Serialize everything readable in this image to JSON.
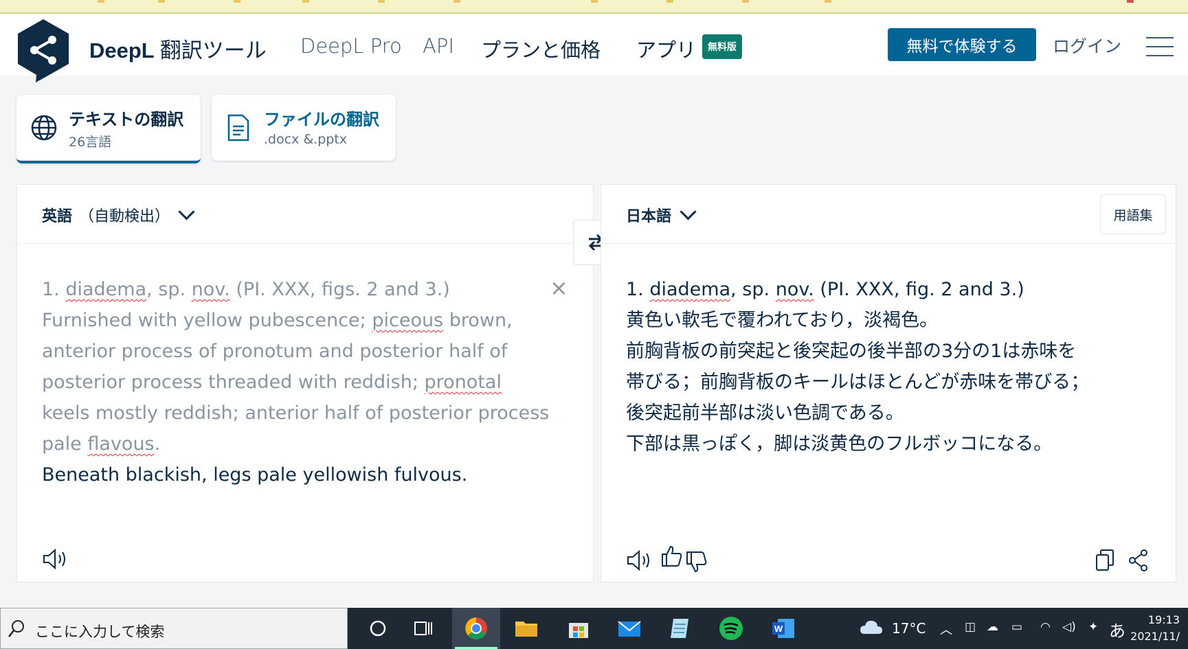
{
  "header": {
    "brand": "DeepL",
    "brand_sub": "翻訳ツール",
    "nav": [
      "DeepL Pro",
      "API",
      "プランと価格",
      "アプリ"
    ],
    "badge": "無料版",
    "try_button": "無料で体験する",
    "login": "ログイン"
  },
  "modes": [
    {
      "title": "テキストの翻訳",
      "sub": "26言語",
      "icon": "globe-icon"
    },
    {
      "title": "ファイルの翻訳",
      "sub": ".docx &.pptx",
      "icon": "document-icon"
    }
  ],
  "source": {
    "lang": "英語",
    "auto": "（自動検出）",
    "lines": [
      "1. diadema, sp. nov. (PI. XXX, figs. 2 and 3.)",
      "Furnished with yellow pubescence; piceous brown,",
      "anterior process of pronotum and posterior half of",
      "posterior process threaded with reddish; pronotal",
      "keels mostly reddish; anterior half of posterior process",
      "pale flavous.",
      "Beneath blackish, legs pale yellowish fulvous."
    ]
  },
  "target": {
    "lang": "日本語",
    "glossary": "用語集",
    "lines": [
      "1. diadema, sp. nov. (PI. XXX, fig. 2 and 3.)",
      "黄色い軟毛で覆われており，淡褐色。",
      "前胸背板の前突起と後突起の後半部の3分の1は赤味を",
      "帯びる；前胸背板のキールはほとんどが赤味を帯びる；",
      "後突起前半部は淡い色調である。",
      "下部は黒っぽく，脚は淡黄色のフルボッコになる。"
    ]
  },
  "taskbar": {
    "search_placeholder": "ここに入力して検索",
    "temperature": "17°C",
    "ime": "あ",
    "time": "19:13",
    "date": "2021/11/"
  },
  "colors": {
    "accent": "#006494",
    "navy": "#0f2b46",
    "badge": "#0c7a6d"
  }
}
